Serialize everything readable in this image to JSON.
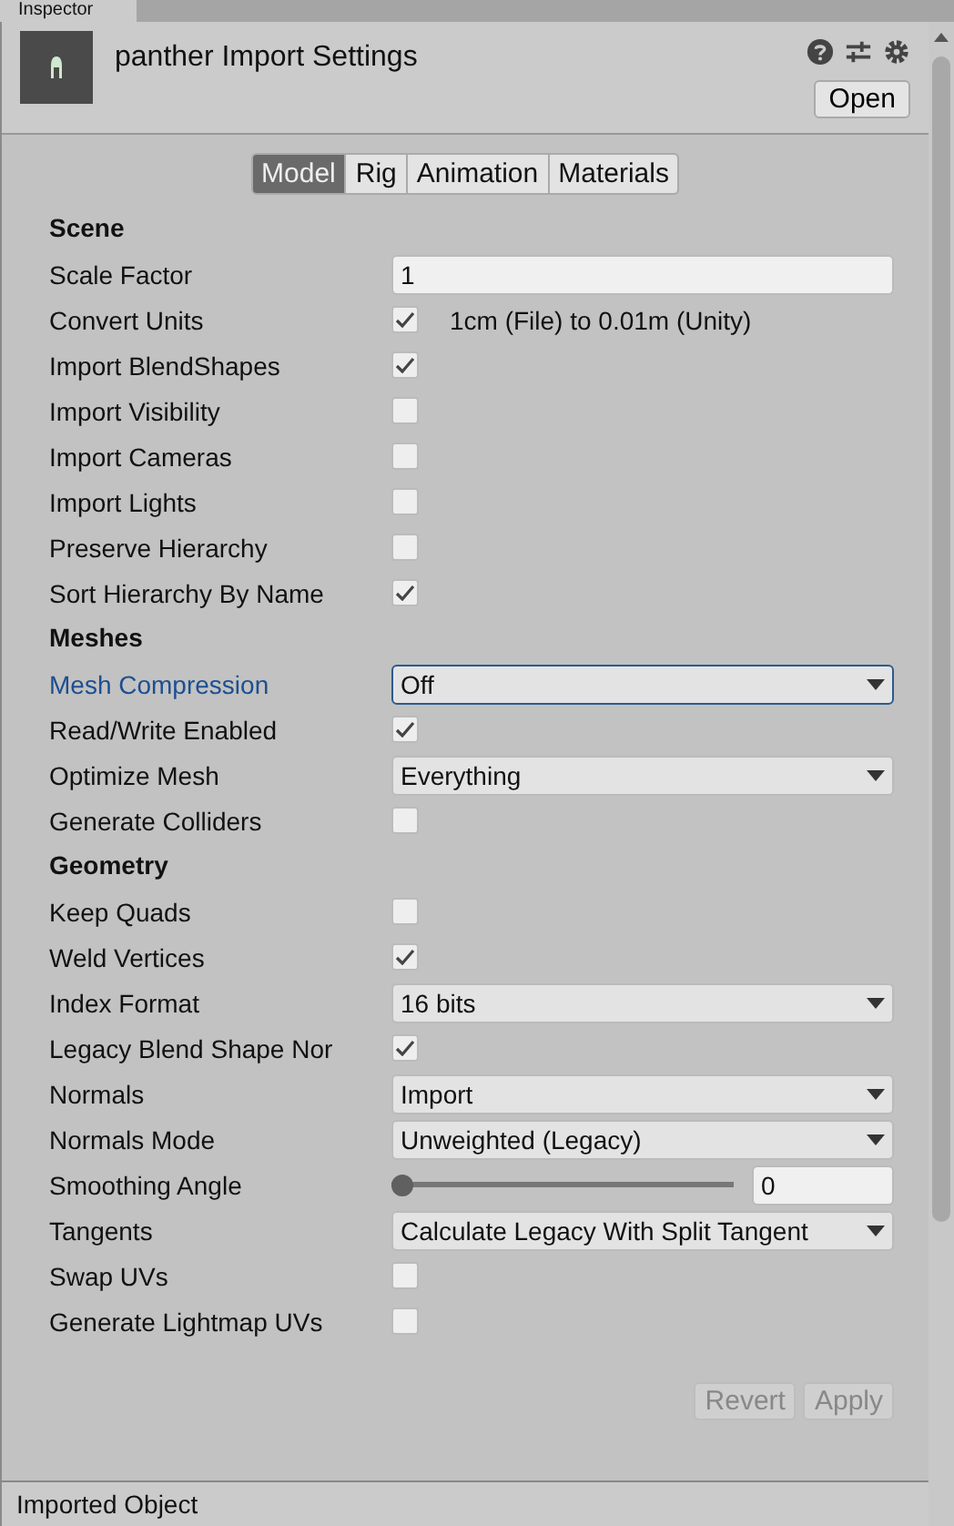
{
  "window": {
    "tab": "Inspector"
  },
  "header": {
    "title": "panther Import Settings",
    "open_button": "Open"
  },
  "tabs": [
    {
      "label": "Model",
      "selected": true
    },
    {
      "label": "Rig",
      "selected": false
    },
    {
      "label": "Animation",
      "selected": false
    },
    {
      "label": "Materials",
      "selected": false
    }
  ],
  "rows": [
    {
      "kind": "heading",
      "label": "Scene"
    },
    {
      "kind": "text",
      "label": "Scale Factor",
      "value": "1",
      "focused": false
    },
    {
      "kind": "checkbox",
      "label": "Convert Units",
      "checked": true,
      "note": "1cm (File) to 0.01m (Unity)",
      "focused": false
    },
    {
      "kind": "checkbox",
      "label": "Import BlendShapes",
      "checked": true,
      "focused": false
    },
    {
      "kind": "checkbox",
      "label": "Import Visibility",
      "checked": false,
      "focused": false
    },
    {
      "kind": "checkbox",
      "label": "Import Cameras",
      "checked": false,
      "focused": false
    },
    {
      "kind": "checkbox",
      "label": "Import Lights",
      "checked": false,
      "focused": false
    },
    {
      "kind": "checkbox",
      "label": "Preserve Hierarchy",
      "checked": false,
      "focused": false
    },
    {
      "kind": "checkbox",
      "label": "Sort Hierarchy By Name",
      "checked": true,
      "focused": false
    },
    {
      "kind": "heading",
      "label": "Meshes"
    },
    {
      "kind": "dropdown",
      "label": "Mesh Compression",
      "value": "Off",
      "focused": true
    },
    {
      "kind": "checkbox",
      "label": "Read/Write Enabled",
      "checked": true,
      "focused": false
    },
    {
      "kind": "dropdown",
      "label": "Optimize Mesh",
      "value": "Everything",
      "focused": false
    },
    {
      "kind": "checkbox",
      "label": "Generate Colliders",
      "checked": false,
      "focused": false
    },
    {
      "kind": "heading",
      "label": "Geometry"
    },
    {
      "kind": "checkbox",
      "label": "Keep Quads",
      "checked": false,
      "focused": false
    },
    {
      "kind": "checkbox",
      "label": "Weld Vertices",
      "checked": true,
      "focused": false
    },
    {
      "kind": "dropdown",
      "label": "Index Format",
      "value": "16 bits",
      "focused": false
    },
    {
      "kind": "checkbox",
      "label": "Legacy Blend Shape Nor",
      "checked": true,
      "focused": false
    },
    {
      "kind": "dropdown",
      "label": "Normals",
      "value": "Import",
      "focused": false
    },
    {
      "kind": "dropdown",
      "label": "Normals Mode",
      "value": "Unweighted (Legacy)",
      "focused": false
    },
    {
      "kind": "slider",
      "label": "Smoothing Angle",
      "level": 0,
      "value": "0",
      "focused": false
    },
    {
      "kind": "dropdown",
      "label": "Tangents",
      "value": "Calculate Legacy With Split Tangent",
      "focused": false
    },
    {
      "kind": "checkbox",
      "label": "Swap UVs",
      "checked": false,
      "focused": false
    },
    {
      "kind": "checkbox",
      "label": "Generate Lightmap UVs",
      "checked": false,
      "focused": false
    }
  ],
  "actions": [
    {
      "label": "Revert",
      "disabled": true
    },
    {
      "label": "Apply",
      "disabled": true
    }
  ],
  "status_bar": "Imported Object"
}
